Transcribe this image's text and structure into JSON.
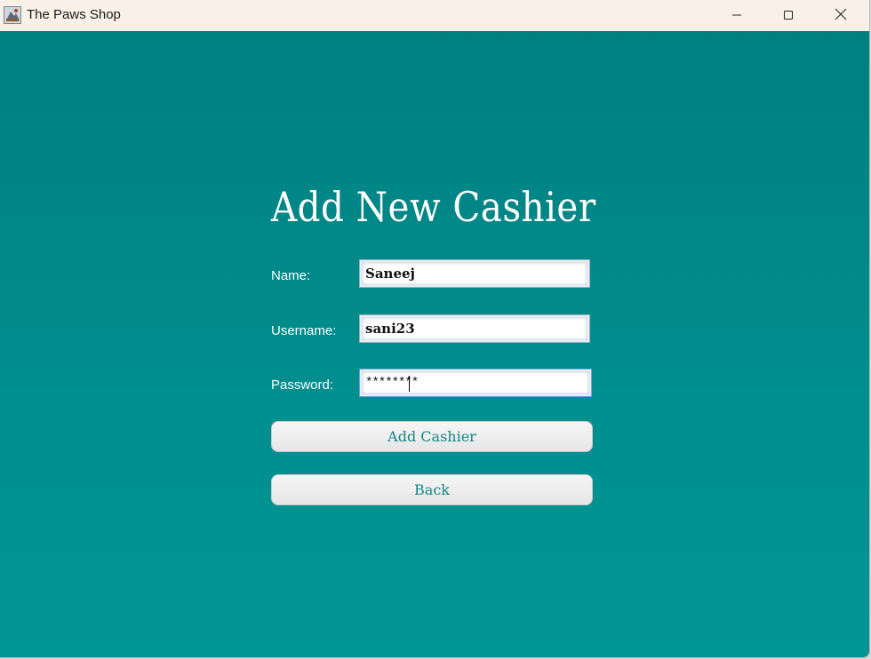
{
  "window": {
    "title": "The Paws Shop",
    "app_icon": "paws-shop-app-icon",
    "controls": {
      "minimize_icon": "minimize-icon",
      "maximize_icon": "maximize-icon",
      "close_icon": "close-icon"
    }
  },
  "colors": {
    "background_top": "#007f7f",
    "background_bottom": "#009696",
    "button_text": "#138585",
    "title_text": "#ffffff"
  },
  "form": {
    "title": "Add New Cashier",
    "fields": {
      "name": {
        "label": "Name:",
        "value": "Saneej"
      },
      "username": {
        "label": "Username:",
        "value": "sani23"
      },
      "password": {
        "label": "Password:",
        "value": "********"
      }
    },
    "buttons": {
      "add": "Add Cashier",
      "back": "Back"
    }
  }
}
